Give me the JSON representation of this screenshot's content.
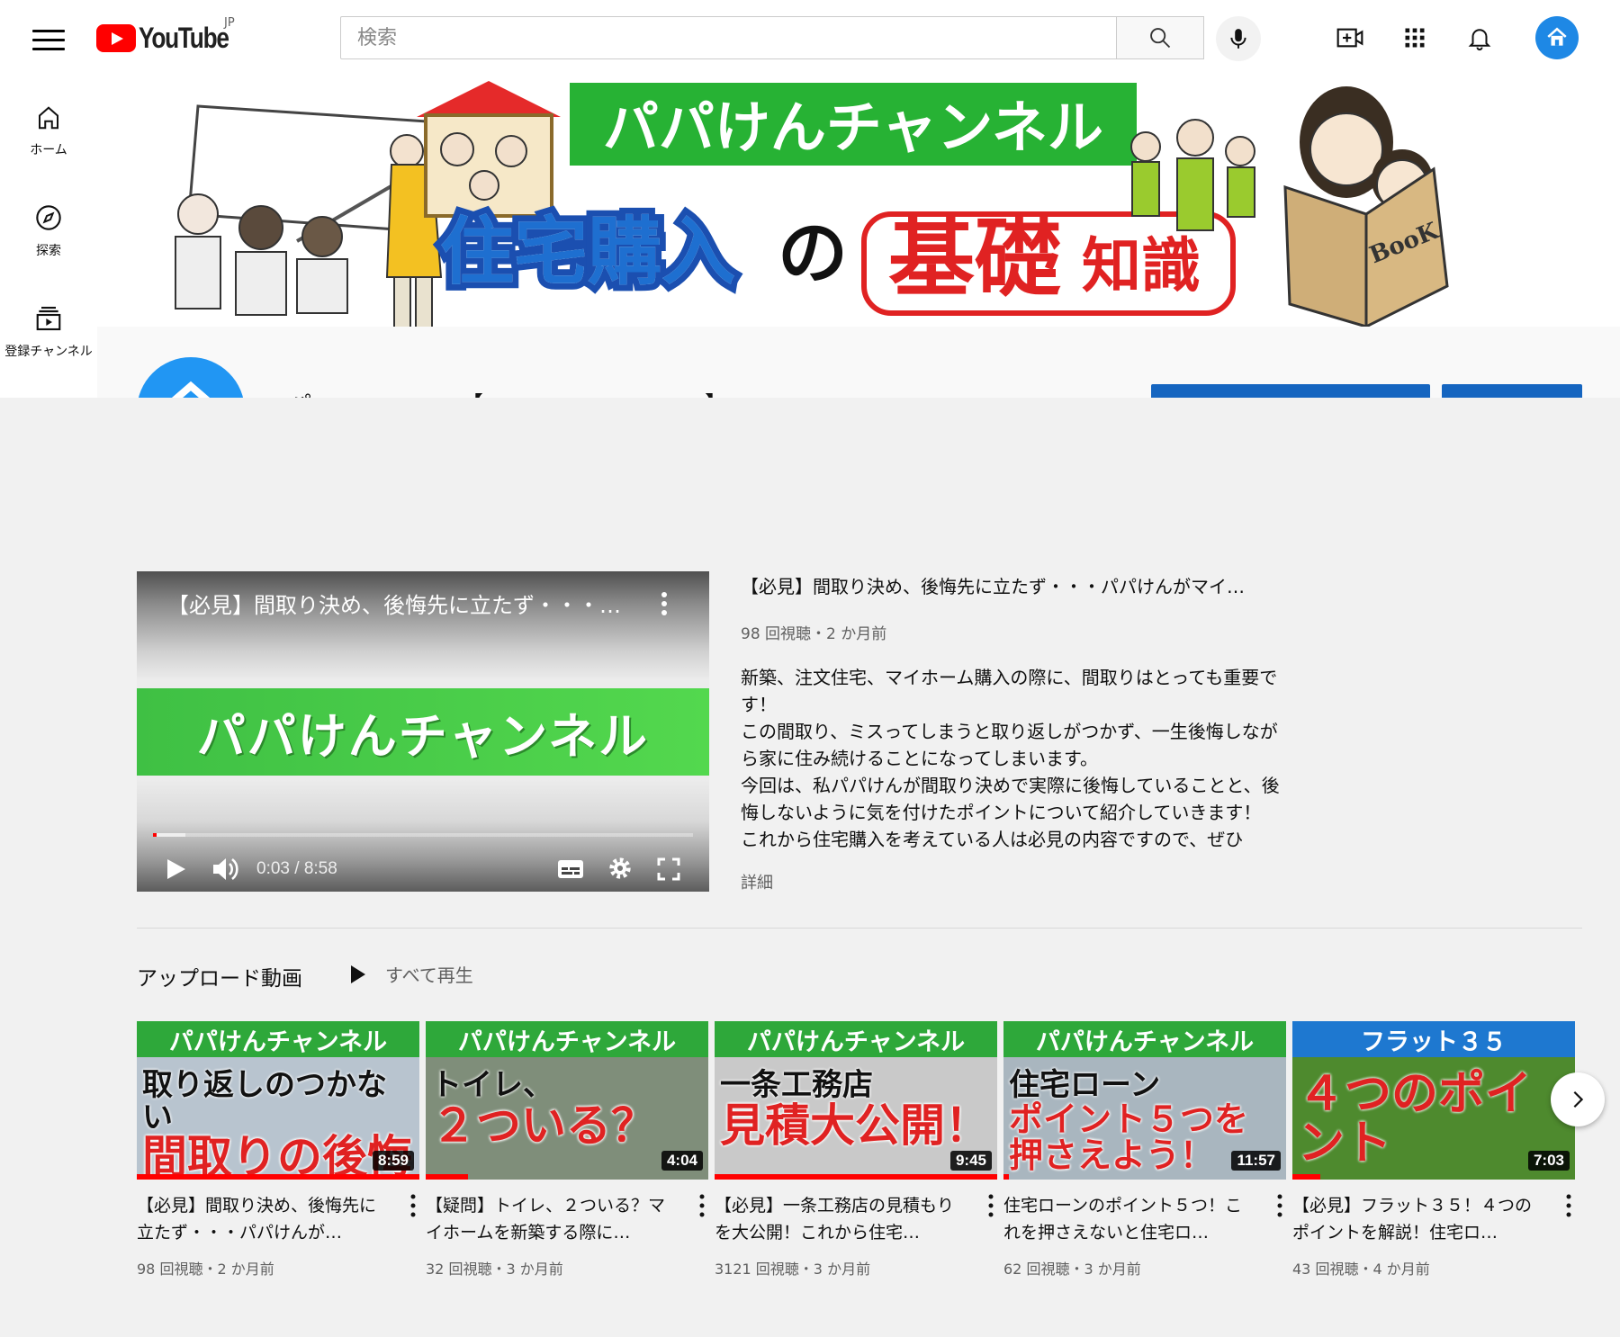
{
  "masthead": {
    "logo_text": "YouTube",
    "country_code": "JP",
    "search_placeholder": "検索",
    "search_value": "",
    "icons": [
      "menu-icon",
      "search-icon",
      "mic-icon",
      "create-video-icon",
      "apps-grid-icon",
      "notifications-bell-icon",
      "account-avatar-icon"
    ]
  },
  "guide": {
    "items": [
      {
        "label": "ホーム",
        "icon": "home-icon"
      },
      {
        "label": "探索",
        "icon": "compass-icon"
      },
      {
        "label": "登録チャンネル",
        "icon": "subscriptions-icon"
      }
    ]
  },
  "banner": {
    "title": "パパけんチャンネル",
    "sub_left": "住宅購入",
    "sub_mid": "の",
    "sub_right_big": "基礎",
    "sub_right_small": "知識",
    "book_text": "BooK"
  },
  "featured": {
    "overlay_title": "【必見】間取り決め、後悔先に立たず・・・パパけんがマイ…",
    "band_text": "パパけんチャンネル",
    "time": "0:03 / 8:58",
    "progress_fraction": 0.006,
    "buffered_fraction": 0.06,
    "title": "【必見】間取り決め、後悔先に立たず・・・パパけんがマイ…",
    "meta": "98 回視聴・2 か月前",
    "description": [
      "新築、注文住宅、マイホーム購入の際に、間取りはとっても重要です！",
      "この間取り、ミスってしまうと取り返しがつかず、一生後悔しながら家に住み続けることになってしまいます。",
      "今回は、私パパけんが間取り決めで実際に後悔していることと、後悔しないように気を付けたポイントについて紹介していきます！",
      "これから住宅購入を考えている人は必見の内容ですので、ぜひ"
    ],
    "more": "詳細"
  },
  "shelf": {
    "title": "アップロード動画",
    "play_all": "すべて再生",
    "videos": [
      {
        "head": "パパけんチャンネル",
        "line1": "取り返しのつかない",
        "line2": "間取りの後悔",
        "duration": "8:59",
        "watched": 1.0,
        "title": "【必見】間取り決め、後悔先に立たず・・・パパけんが…",
        "meta": "98 回視聴・2 か月前",
        "bg": "#b8c4cf",
        "head_bg": "#2ea83a"
      },
      {
        "head": "パパけんチャンネル",
        "line1": "トイレ、",
        "line2": "２ついる？",
        "duration": "4:04",
        "watched": 0.15,
        "title": "【疑問】トイレ、２ついる？マイホームを新築する際に…",
        "meta": "32 回視聴・3 か月前",
        "bg": "#7f8e7a",
        "head_bg": "#2ea83a"
      },
      {
        "head": "パパけんチャンネル",
        "line1": "一条工務店",
        "line2": "見積大公開！",
        "duration": "9:45",
        "watched": 1.0,
        "title": "【必見】一条工務店の見積もりを大公開！これから住宅…",
        "meta": "3121 回視聴・3 か月前",
        "bg": "#c9c9c9",
        "head_bg": "#2ea83a"
      },
      {
        "head": "パパけんチャンネル",
        "line1": "住宅ローン",
        "line2": "ポイント５つを押さえよう！",
        "duration": "11:57",
        "watched": 0.02,
        "title": "住宅ローンのポイント５つ！これを押さえないと住宅ロ…",
        "meta": "62 回視聴・3 か月前",
        "bg": "#a9b6bf",
        "head_bg": "#2ea83a"
      },
      {
        "head": "フラット３５",
        "line1": "４つのポイント",
        "line2": "",
        "duration": "7:03",
        "watched": 0.1,
        "title": "【必見】フラット３５！４つのポイントを解説！住宅ロ…",
        "meta": "43 回視聴・4 か月前",
        "bg": "#4e8a2e",
        "head_bg": "#1e78d0"
      }
    ]
  },
  "colors": {
    "brand_red": "#ff0000",
    "accent_blue": "#1565c0",
    "banner_green": "#2ea83a"
  }
}
